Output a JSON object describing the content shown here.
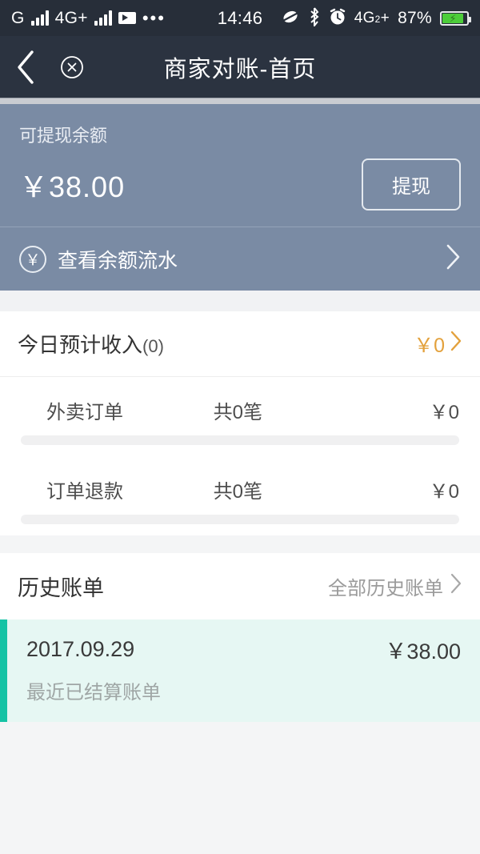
{
  "status_bar": {
    "carrier_letter": "G",
    "network_label": "4G+",
    "video_icon": "video-recording-icon",
    "more_icon": "more-dots-icon",
    "time": "14:46",
    "mute_icon": "mute-icon",
    "bluetooth_icon": "bluetooth-icon",
    "alarm_icon": "alarm-clock-icon",
    "second_sim_label": "4G",
    "second_sim_sub": "2",
    "second_sim_plus": "+",
    "battery_percent": "87%",
    "battery_charging_icon": "lightning-bolt-icon"
  },
  "nav": {
    "back_icon": "back-chevron-icon",
    "close_icon": "close-circle-icon",
    "title": "商家对账-首页"
  },
  "balance": {
    "label": "可提现余额",
    "amount": "￥38.00",
    "withdraw_label": "提现",
    "flow_icon": "yen-circle-icon",
    "flow_label": "查看余额流水",
    "flow_chevron_icon": "chevron-right-icon",
    "card_color": "#7a8ba4"
  },
  "income": {
    "title": "今日预计收入",
    "count": "(0)",
    "total": "￥0",
    "chevron_icon": "chevron-right-icon",
    "accent_color": "#e3a13c",
    "rows": [
      {
        "name": "外卖订单",
        "count": "共0笔",
        "amount": "￥0",
        "progress": 0
      },
      {
        "name": "订单退款",
        "count": "共0笔",
        "amount": "￥0",
        "progress": 0
      }
    ]
  },
  "history": {
    "title": "历史账单",
    "all_label": "全部历史账单",
    "chevron_icon": "chevron-right-icon",
    "accent_color": "#15c3a5",
    "bills": [
      {
        "date": "2017.09.29",
        "amount": "￥38.00",
        "subtitle": "最近已结算账单"
      }
    ]
  }
}
